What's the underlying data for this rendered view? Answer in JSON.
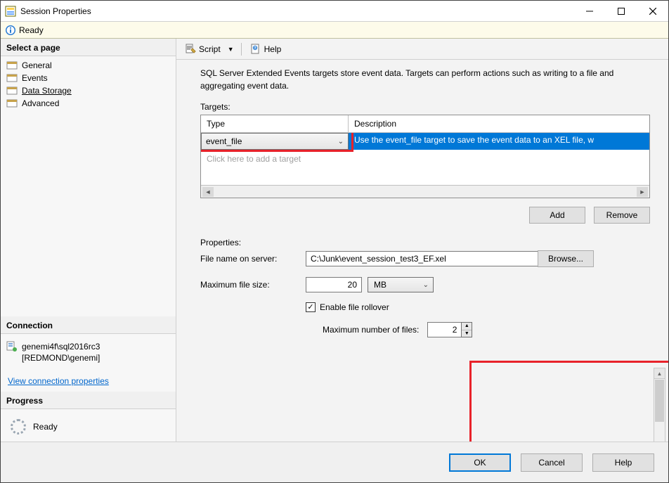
{
  "window": {
    "title": "Session Properties"
  },
  "readybar": {
    "text": "Ready"
  },
  "sidebar": {
    "select_page_head": "Select a page",
    "pages": [
      {
        "label": "General"
      },
      {
        "label": "Events"
      },
      {
        "label": "Data Storage"
      },
      {
        "label": "Advanced"
      }
    ],
    "connection_head": "Connection",
    "connection_line1": "genemi4f\\sql2016rc3",
    "connection_line2": "[REDMOND\\genemi]",
    "view_link": "View connection properties",
    "progress_head": "Progress",
    "progress_text": "Ready"
  },
  "toolbar": {
    "script": "Script",
    "help": "Help"
  },
  "main": {
    "desc": "SQL Server Extended Events targets store event data. Targets can perform actions such as writing to a file and aggregating event data.",
    "targets_label": "Targets:",
    "col_type": "Type",
    "col_desc": "Description",
    "row_type": "event_file",
    "row_desc": "Use the event_file target to save the event data to an XEL file, w",
    "add_placeholder": "Click here to add a target",
    "btn_add": "Add",
    "btn_remove": "Remove",
    "properties_label": "Properties:",
    "file_label": "File name on server:",
    "file_value": "C:\\Junk\\event_session_test3_EF.xel",
    "browse": "Browse...",
    "maxsize_label": "Maximum file size:",
    "maxsize_value": "20",
    "maxsize_unit": "MB",
    "rollover_label": "Enable file rollover",
    "maxfiles_label": "Maximum number of files:",
    "maxfiles_value": "2"
  },
  "footer": {
    "ok": "OK",
    "cancel": "Cancel",
    "help": "Help"
  }
}
